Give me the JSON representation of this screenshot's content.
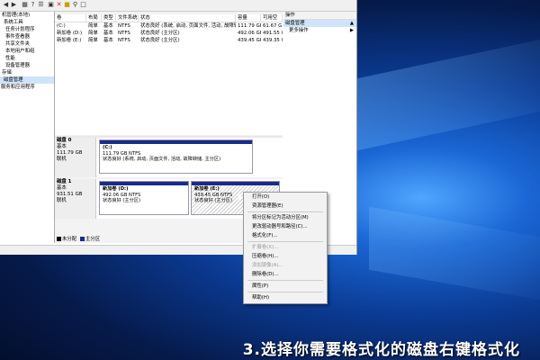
{
  "tree": {
    "items": [
      "机管理(本地)",
      "系统工具",
      "任务计划程序",
      "事件查看器",
      "共享文件夹",
      "本地用户和组",
      "性能",
      "设备管理器",
      "存储",
      "磁盘管理",
      "服务和应用程序"
    ]
  },
  "table": {
    "headers": [
      "卷",
      "布局",
      "类型",
      "文件系统",
      "状态",
      "容量",
      "可用空"
    ],
    "rows": [
      [
        "(C:)",
        "简单",
        "基本",
        "NTFS",
        "状态良好 (系统, 启动, 页面文件, 活动, 故障转储...",
        "111.79 GB",
        "61.67 G"
      ],
      [
        "新加卷 (D:)",
        "简单",
        "基本",
        "NTFS",
        "状态良好 (主分区)",
        "492.06 GB",
        "491.55 G"
      ],
      [
        "新加卷 (E:)",
        "简单",
        "基本",
        "NTFS",
        "状态良好 (主分区)",
        "439.45 GB",
        "439.35 G"
      ]
    ]
  },
  "disks": [
    {
      "name": "磁盘 0",
      "type": "基本",
      "size": "111.79 GB",
      "status": "联机",
      "partitions": [
        {
          "title": "(C:)",
          "size": "111.79 GB NTFS",
          "status": "状态良好 (系统, 启动, 页面文件, 活动, 故障转储, 主分区)"
        }
      ]
    },
    {
      "name": "磁盘 1",
      "type": "基本",
      "size": "931.51 GB",
      "status": "联机",
      "partitions": [
        {
          "title": "新加卷 (D:)",
          "size": "492.06 GB NTFS",
          "status": "状态良好 (主分区)"
        },
        {
          "title": "新加卷 (E:)",
          "size": "439.45 GB NTFS",
          "status": "状态良好 (主分区)"
        }
      ]
    }
  ],
  "legend": {
    "unallocated": "未分配",
    "primary": "主分区"
  },
  "actions": {
    "header": "操作",
    "selected": "磁盘管理",
    "more": "更多操作"
  },
  "context_menu": {
    "open": "打开(O)",
    "explore": "资源管理器(E)",
    "mark_active": "将分区标记为活动分区(M)",
    "change_letter": "更改驱动器号和路径(C)...",
    "format": "格式化(F)...",
    "extend": "扩展卷(X)...",
    "shrink": "压缩卷(H)...",
    "mirror": "添加镜像(A)...",
    "delete": "删除卷(D)...",
    "properties": "属性(P)",
    "help": "帮助(H)"
  },
  "caption": "3.选择你需要格式化的磁盘右键格式化",
  "colors": {
    "primary_partition": "#1a2b8c",
    "unallocated": "#000000",
    "selection": "#cfe4fa"
  }
}
